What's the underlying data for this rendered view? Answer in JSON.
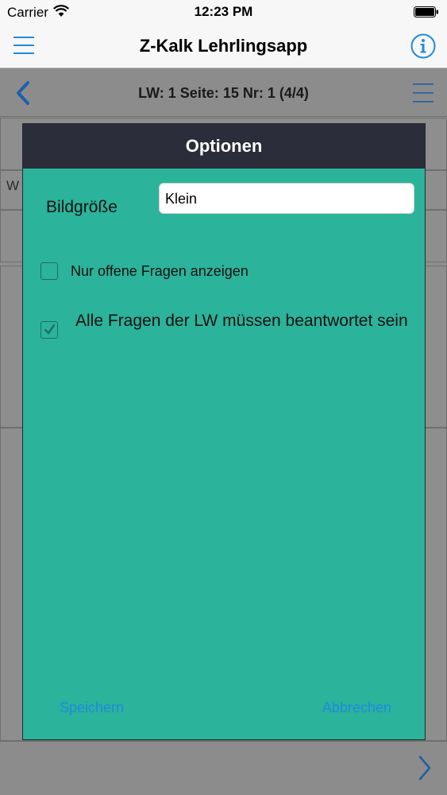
{
  "status_bar": {
    "carrier": "Carrier",
    "time": "12:23 PM"
  },
  "nav": {
    "title": "Z-Kalk Lehrlingsapp",
    "left_icon": "menu-icon",
    "right_icon": "info-icon"
  },
  "subheader": {
    "title": "LW: 1 Seite: 15 Nr: 1 (4/4)",
    "left_icon": "back-chevron-icon",
    "right_icon": "list-icon"
  },
  "background": {
    "partial_text": "W"
  },
  "modal": {
    "title": "Optionen",
    "image_size_label": "Bildgröße",
    "image_size_value": "Klein",
    "option_open_only": {
      "label": "Nur offene Fragen anzeigen",
      "checked": false
    },
    "option_all_required": {
      "label": "Alle Fragen der LW müssen beantwortet sein",
      "checked": true
    },
    "save_label": "Speichern",
    "cancel_label": "Abbrechen"
  },
  "colors": {
    "accent": "#1e8bdf",
    "modal_bg": "#2bb39b",
    "modal_header": "#2b2d3a"
  }
}
